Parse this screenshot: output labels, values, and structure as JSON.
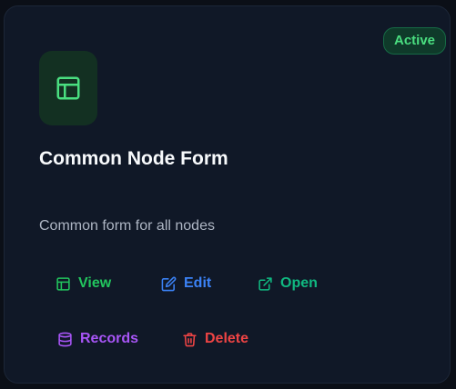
{
  "card": {
    "status": "Active",
    "title": "Common Node Form",
    "description": "Common form for all nodes",
    "icon": "layout-icon"
  },
  "actions": {
    "view": {
      "label": "View",
      "icon": "layout-icon",
      "color": "#22c55e"
    },
    "edit": {
      "label": "Edit",
      "icon": "edit-icon",
      "color": "#3b82f6"
    },
    "open": {
      "label": "Open",
      "icon": "external-link-icon",
      "color": "#10b981"
    },
    "records": {
      "label": "Records",
      "icon": "database-icon",
      "color": "#a855f7"
    },
    "delete": {
      "label": "Delete",
      "icon": "trash-icon",
      "color": "#ef4444"
    }
  },
  "colors": {
    "accent": "#22c55e",
    "card_background": "#101827",
    "page_background": "#0b0f17"
  }
}
